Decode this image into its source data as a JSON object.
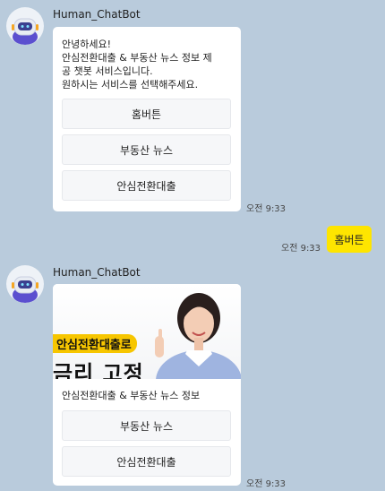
{
  "bot": {
    "name": "Human_ChatBot"
  },
  "messages": {
    "first": {
      "text": "안녕하세요!\n안심전환대출 & 부동산 뉴스 정보 제\n공 챗봇 서비스입니다.\n원하시는 서비스를 선택해주세요.",
      "buttons": [
        "홈버튼",
        "부동산 뉴스",
        "안심전환대출"
      ],
      "time": "오전 9:33"
    },
    "user": {
      "text": "홈버튼",
      "time": "오전 9:33"
    },
    "second": {
      "banner_tag": "안심전환대출로",
      "banner_headline": "금리 고정",
      "text": "안심전환대출 & 부동산 뉴스 정보",
      "buttons": [
        "부동산 뉴스",
        "안심전환대출"
      ],
      "time": "오전 9:33"
    }
  },
  "colors": {
    "background": "#b9cbdc",
    "user_bubble": "#fee500",
    "robot_purple": "#5b4fcf"
  },
  "icons": [
    "robot-avatar-icon"
  ]
}
